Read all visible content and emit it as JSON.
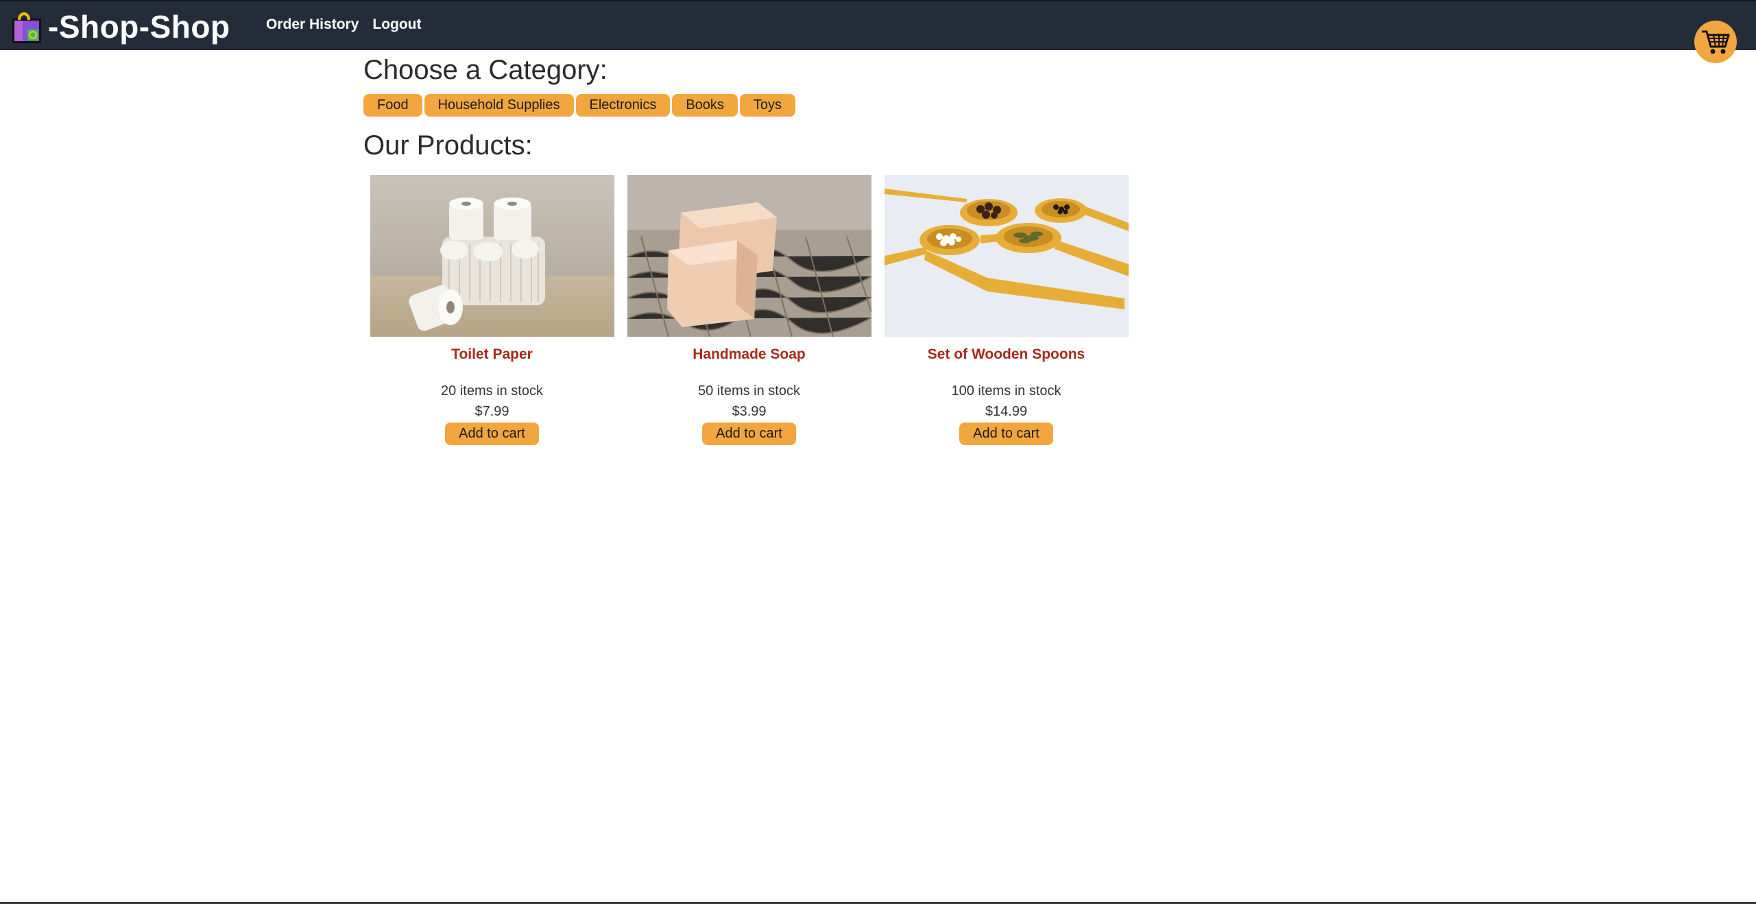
{
  "header": {
    "brand": "-Shop-Shop",
    "nav": [
      "Order History",
      "Logout"
    ]
  },
  "categories": {
    "title": "Choose a Category:",
    "items": [
      "Food",
      "Household Supplies",
      "Electronics",
      "Books",
      "Toys"
    ]
  },
  "products": {
    "title": "Our Products:",
    "add_label": "Add to cart",
    "items": [
      {
        "name": "Toilet Paper",
        "stock": "20 items in stock",
        "price": "$7.99",
        "image": "toilet-paper-photo"
      },
      {
        "name": "Handmade Soap",
        "stock": "50 items in stock",
        "price": "$3.99",
        "image": "soap-photo"
      },
      {
        "name": "Set of Wooden Spoons",
        "stock": "100 items in stock",
        "price": "$14.99",
        "image": "wooden-spoons-photo"
      }
    ]
  },
  "icons": {
    "logo": "shopping-bag-icon",
    "cart": "shopping-cart-icon"
  },
  "colors": {
    "nav_bg": "#242c3a",
    "accent": "#f2a640",
    "product_name": "#a52a1a"
  }
}
